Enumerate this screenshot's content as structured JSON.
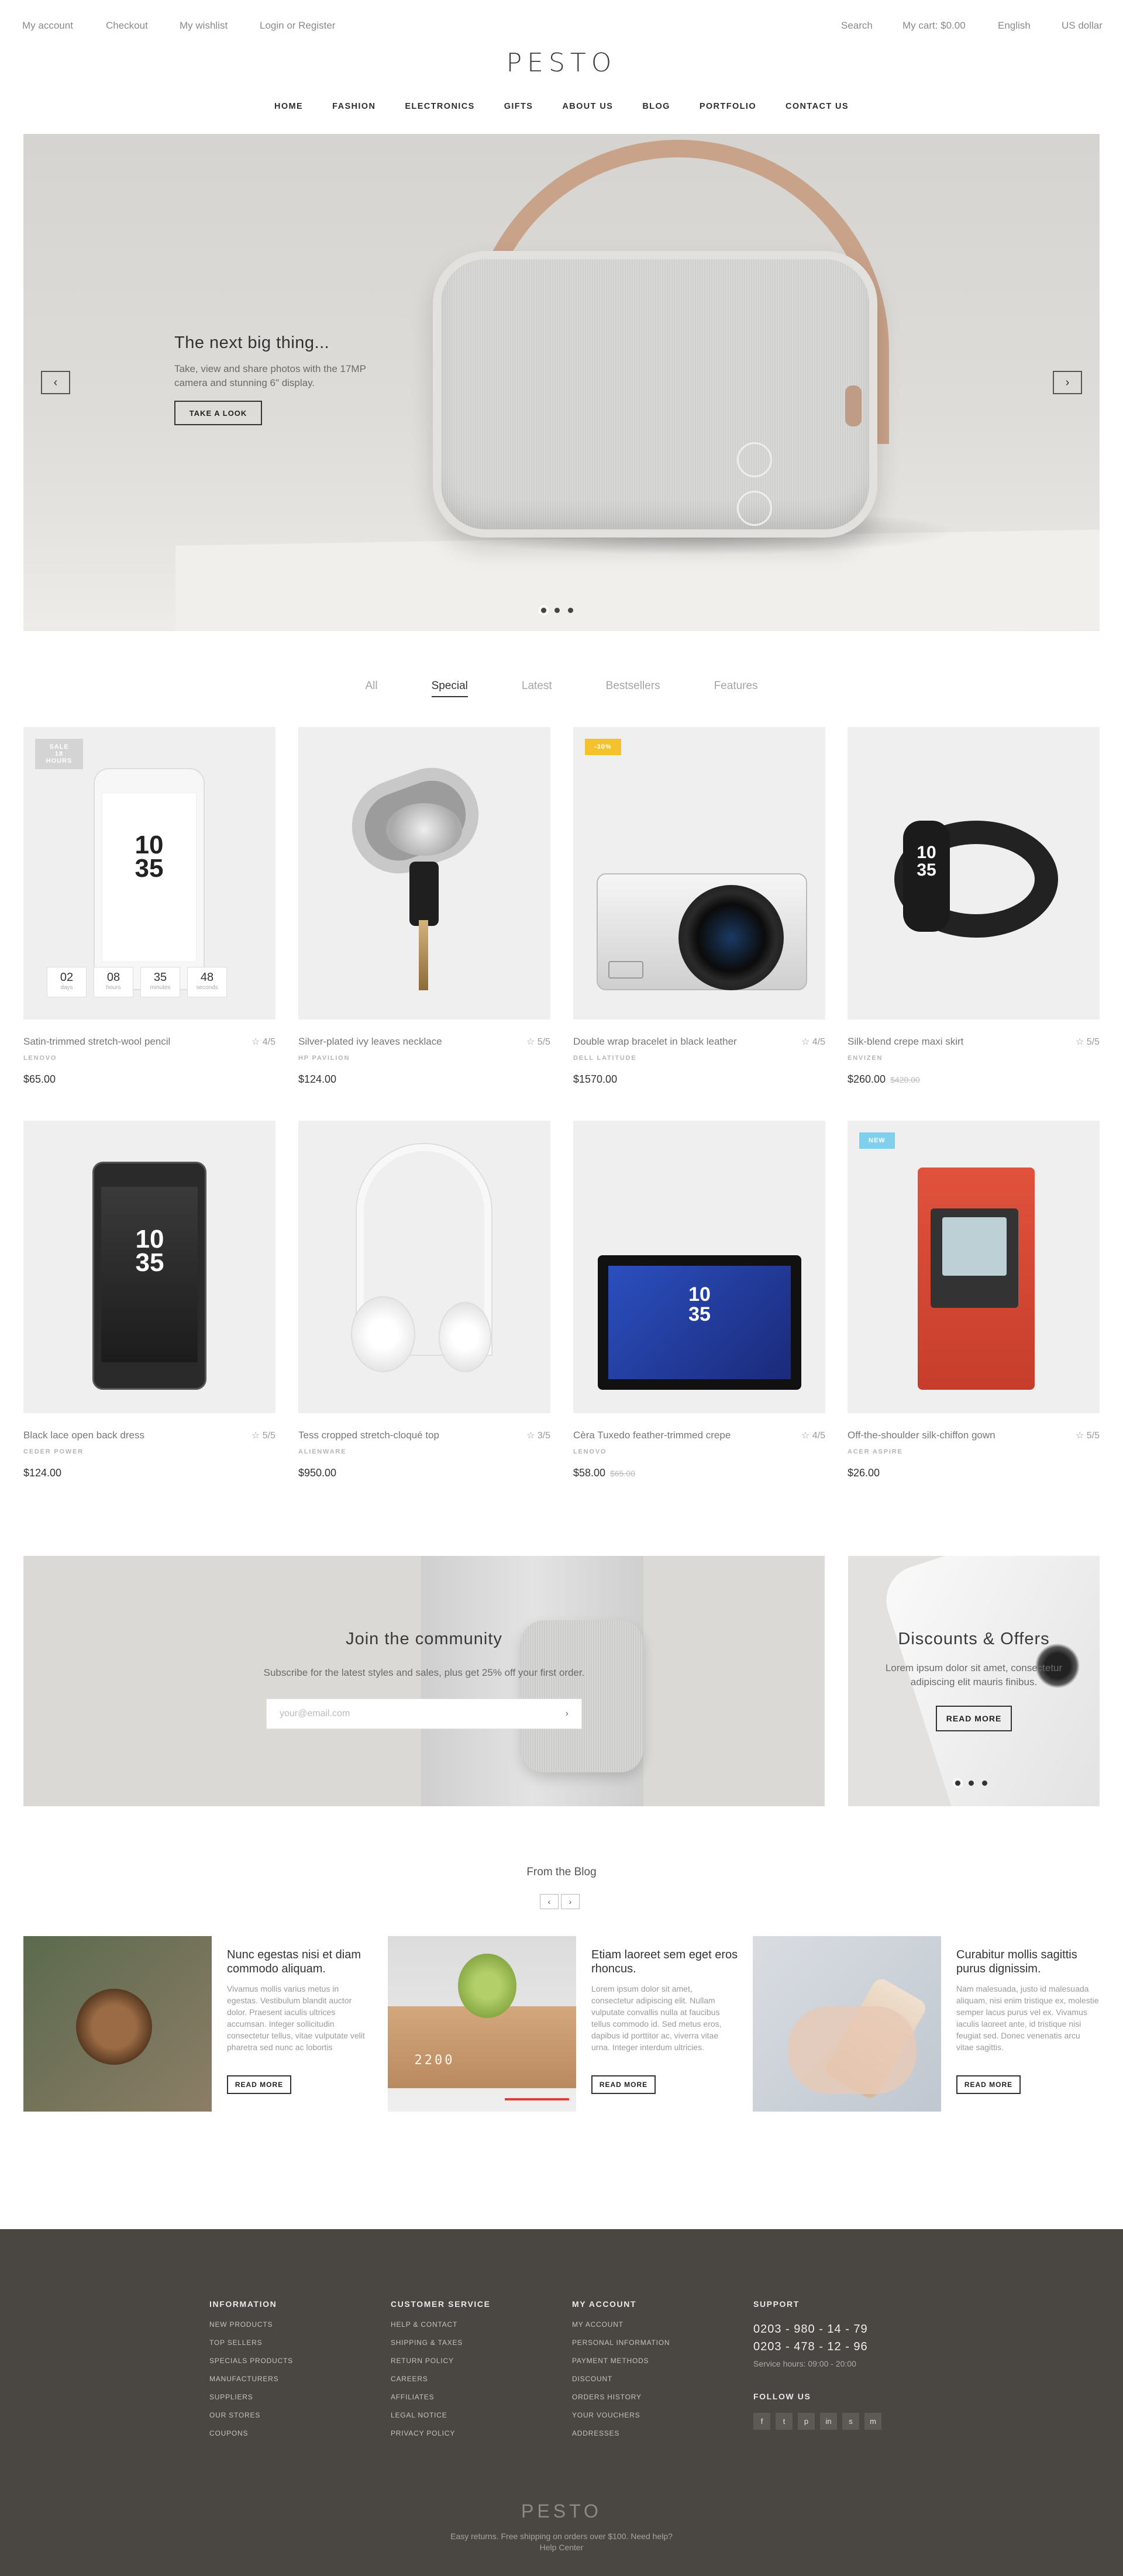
{
  "topbar": {
    "left_links": [
      "My account",
      "Checkout",
      "My wishlist",
      "Login or Register"
    ],
    "search": "Search",
    "cart": "My cart: $0.00",
    "language": "English",
    "currency": "US dollar"
  },
  "brand": "PESTO",
  "nav": [
    "HOME",
    "FASHION",
    "ELECTRONICS",
    "GIFTS",
    "ABOUT US",
    "BLOG",
    "PORTFOLIO",
    "CONTACT US"
  ],
  "hero": {
    "title": "The next big thing...",
    "subtitle": "Take, view and share photos with the 17MP camera and stunning 6\" display.",
    "button": "TAKE A LOOK",
    "prev_icon": "chevron-left-icon",
    "next_icon": "chevron-right-icon",
    "slides": 3,
    "active_slide": 1
  },
  "product_tabs": [
    "All",
    "Special",
    "Latest",
    "Bestsellers",
    "Features"
  ],
  "active_tab": "Special",
  "colors": {
    "sale_badge": "#d4d4d4",
    "discount_badge": "#f3c22c",
    "new_badge": "#7fd0ee",
    "footer_bg": "#4a4743"
  },
  "products": [
    {
      "name": "Satin-trimmed stretch-wool pencil",
      "rating": "4/5",
      "brand": "LENOVO",
      "price": "$65.00",
      "old_price": "",
      "badge": "SALE 18 HOURS",
      "countdown": [
        {
          "v": "02",
          "u": "days"
        },
        {
          "v": "08",
          "u": "hours"
        },
        {
          "v": "35",
          "u": "minutes"
        },
        {
          "v": "48",
          "u": "seconds"
        }
      ],
      "clock": [
        "10",
        "35"
      ]
    },
    {
      "name": "Silver-plated ivy leaves necklace",
      "rating": "5/5",
      "brand": "HP PAVILION",
      "price": "$124.00",
      "old_price": ""
    },
    {
      "name": "Double wrap bracelet in black leather",
      "rating": "4/5",
      "brand": "DELL LATITUDE",
      "price": "$1570.00",
      "old_price": "",
      "badge": "-30%"
    },
    {
      "name": "Silk-blend crepe maxi skirt",
      "rating": "5/5",
      "brand": "ENVIZEN",
      "price": "$260.00",
      "old_price": "$420.00",
      "clock": [
        "10",
        "35"
      ]
    },
    {
      "name": "Black lace open back dress",
      "rating": "5/5",
      "brand": "CEDER POWER",
      "price": "$124.00",
      "old_price": "",
      "clock": [
        "10",
        "35"
      ]
    },
    {
      "name": "Tess cropped stretch-cloqué top",
      "rating": "3/5",
      "brand": "ALIENWARE",
      "price": "$950.00",
      "old_price": ""
    },
    {
      "name": "Cèra Tuxedo feather-trimmed crepe",
      "rating": "4/5",
      "brand": "LENOVO",
      "price": "$58.00",
      "old_price": "$65.00",
      "clock": [
        "10",
        "35"
      ]
    },
    {
      "name": "Off-the-shoulder silk-chiffon gown",
      "rating": "5/5",
      "brand": "ACER ASPIRE",
      "price": "$26.00",
      "old_price": "",
      "badge": "NEW"
    }
  ],
  "community": {
    "title": "Join the community",
    "text": "Subscribe for the latest styles and sales, plus get 25% off your first order.",
    "placeholder": "your@email.com"
  },
  "discounts": {
    "title": "Discounts & Offers",
    "text": "Lorem ipsum dolor sit amet, consectetur adipiscing elit mauris finibus.",
    "button": "READ MORE"
  },
  "blog": {
    "heading": "From the Blog",
    "posts": [
      {
        "title": "Nunc egestas nisi et diam commodo aliquam.",
        "text": "Vivamus mollis varius metus in egestas. Vestibulum blandit auctor dolor. Praesent iaculis ultrices accumsan. Integer sollicitudin consectetur tellus, vitae vulputate velit pharetra sed nunc ac lobortis",
        "button": "READ MORE"
      },
      {
        "title": "Etiam laoreet sem eget eros rhoncus.",
        "text": "Lorem ipsum dolor sit amet, consectetur adipiscing elit. Nullam vulputate convallis nulla at faucibus tellus commodo id. Sed metus eros, dapibus id porttitor ac, viverra vitae urna. Integer interdum ultricies.",
        "button": "READ MORE",
        "clock_text": "2200"
      },
      {
        "title": "Curabitur mollis sagittis purus dignissim.",
        "text": "Nam malesuada, justo id malesuada aliquam, nisi enim tristique ex, molestie semper lacus purus vel ex. Vivamus iaculis laoreet ante, id tristique nisi feugiat sed. Donec venenatis arcu vitae sagittis.",
        "button": "READ MORE"
      }
    ]
  },
  "footer": {
    "information": {
      "title": "INFORMATION",
      "links": [
        "NEW PRODUCTS",
        "TOP SELLERS",
        "SPECIALS PRODUCTS",
        "MANUFACTURERS",
        "SUPPLIERS",
        "OUR STORES",
        "COUPONS"
      ]
    },
    "customer_service": {
      "title": "CUSTOMER SERVICE",
      "links": [
        "HELP & CONTACT",
        "SHIPPING & TAXES",
        "RETURN POLICY",
        "CAREERS",
        "AFFILIATES",
        "LEGAL NOTICE",
        "PRIVACY POLICY"
      ]
    },
    "my_account": {
      "title": "MY ACCOUNT",
      "links": [
        "MY ACCOUNT",
        "PERSONAL INFORMATION",
        "PAYMENT METHODS",
        "DISCOUNT",
        "ORDERS HISTORY",
        "YOUR VOUCHERS",
        "ADDRESSES"
      ]
    },
    "support": {
      "title": "SUPPORT",
      "phone1": "0203 - 980 - 14 - 79",
      "phone2": "0203 - 478 - 12 - 96",
      "hours": "Service hours: 09:00 - 20:00"
    },
    "follow": {
      "title": "FOLLOW US",
      "icons": [
        "f",
        "t",
        "p",
        "in",
        "s",
        "m"
      ]
    },
    "logo": "PESTO",
    "bottom_line1": "Easy returns. Free shipping on orders over $100. Need help?",
    "bottom_line2": "Help Center"
  }
}
